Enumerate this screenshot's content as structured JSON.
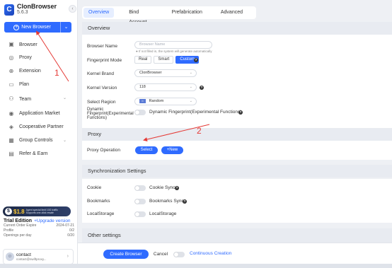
{
  "brand": {
    "name": "ClonBrowser",
    "version": "5.6.3"
  },
  "sidebar": {
    "collapse_icon": "chevron-left-icon",
    "new_browser_label": "New Browser",
    "items": [
      {
        "label": "Browser",
        "icon": "browser-icon",
        "glyph": "▣"
      },
      {
        "label": "Proxy",
        "icon": "globe-icon",
        "glyph": "◎"
      },
      {
        "label": "Extension",
        "icon": "extension-icon",
        "glyph": "⊕"
      },
      {
        "label": "Plan",
        "icon": "plan-icon",
        "glyph": "▭"
      },
      {
        "label": "Team",
        "icon": "team-icon",
        "glyph": "⚇"
      },
      {
        "label": "Application Market",
        "icon": "market-icon",
        "glyph": "◉"
      },
      {
        "label": "Cooperative Partner",
        "icon": "partner-icon",
        "glyph": "◈"
      },
      {
        "label": "Group Controls",
        "icon": "group-control-icon",
        "glyph": "▦"
      },
      {
        "label": "Refer & Earn",
        "icon": "refer-icon",
        "glyph": "▤"
      }
    ],
    "promo": {
      "price": "$1.8",
      "text_line1": "Agent special limit 10G traffic",
      "text_line2": "Supports one-click resale"
    },
    "trial": {
      "title": "Trial Edition",
      "upgrade": "+Upgrade version",
      "rows": [
        {
          "label": "Current Order Expire",
          "value": "2024-07-21"
        },
        {
          "label": "Profile",
          "value": "0/2"
        },
        {
          "label": "Openings per day",
          "value": "0/20"
        }
      ]
    },
    "contact": {
      "name": "contact",
      "email": "contact@swiftproxy..."
    }
  },
  "tabs": [
    "Overview",
    "Bind Account",
    "Prefabrication",
    "Advanced"
  ],
  "overview": {
    "title": "Overview",
    "browser_name_label": "Browser Name",
    "browser_name_placeholder": "Browser Name",
    "browser_name_hint": "If not filled in, the system will generate automatically",
    "fingerprint_mode_label": "Fingerprint Mode",
    "fingerprint_modes": [
      "Real",
      "Smart",
      "Custom"
    ],
    "fingerprint_mode_selected": "Custom",
    "kernel_brand_label": "Kernel Brand",
    "kernel_brand_value": "ClonBrowser",
    "kernel_version_label": "Kernel Version",
    "kernel_version_value": "118",
    "region_label": "Select Region",
    "region_value": "Random",
    "dynamic_fp_label": "Dynamic Fingerprint(Experimental Functions)",
    "dynamic_fp_toggle_label": "Dynamic Fingerprint(Experimental Functions)"
  },
  "proxy": {
    "title": "Proxy",
    "operation_label": "Proxy Operation",
    "select_label": "Select",
    "new_label": "+New"
  },
  "sync": {
    "title": "Synchronization Settings",
    "rows": [
      {
        "label": "Cookie",
        "toggle_label": "Cookie Sync",
        "has_help": true
      },
      {
        "label": "Bookmarks",
        "toggle_label": "Bookmarks Sync",
        "has_help": true
      },
      {
        "label": "LocalStorage",
        "toggle_label": "LocalStorage",
        "has_help": false
      }
    ]
  },
  "other": {
    "title": "Other settings"
  },
  "footer": {
    "create_label": "Create Browser",
    "cancel_label": "Cancel",
    "continuous_label": "Continuous Creation"
  },
  "annotations": {
    "marker_1": "1",
    "marker_2": "2",
    "color": "#e53935"
  },
  "colors": {
    "accent": "#2f6bff",
    "section_bg": "#e8ebf1",
    "page_bg": "#eef0f4"
  }
}
